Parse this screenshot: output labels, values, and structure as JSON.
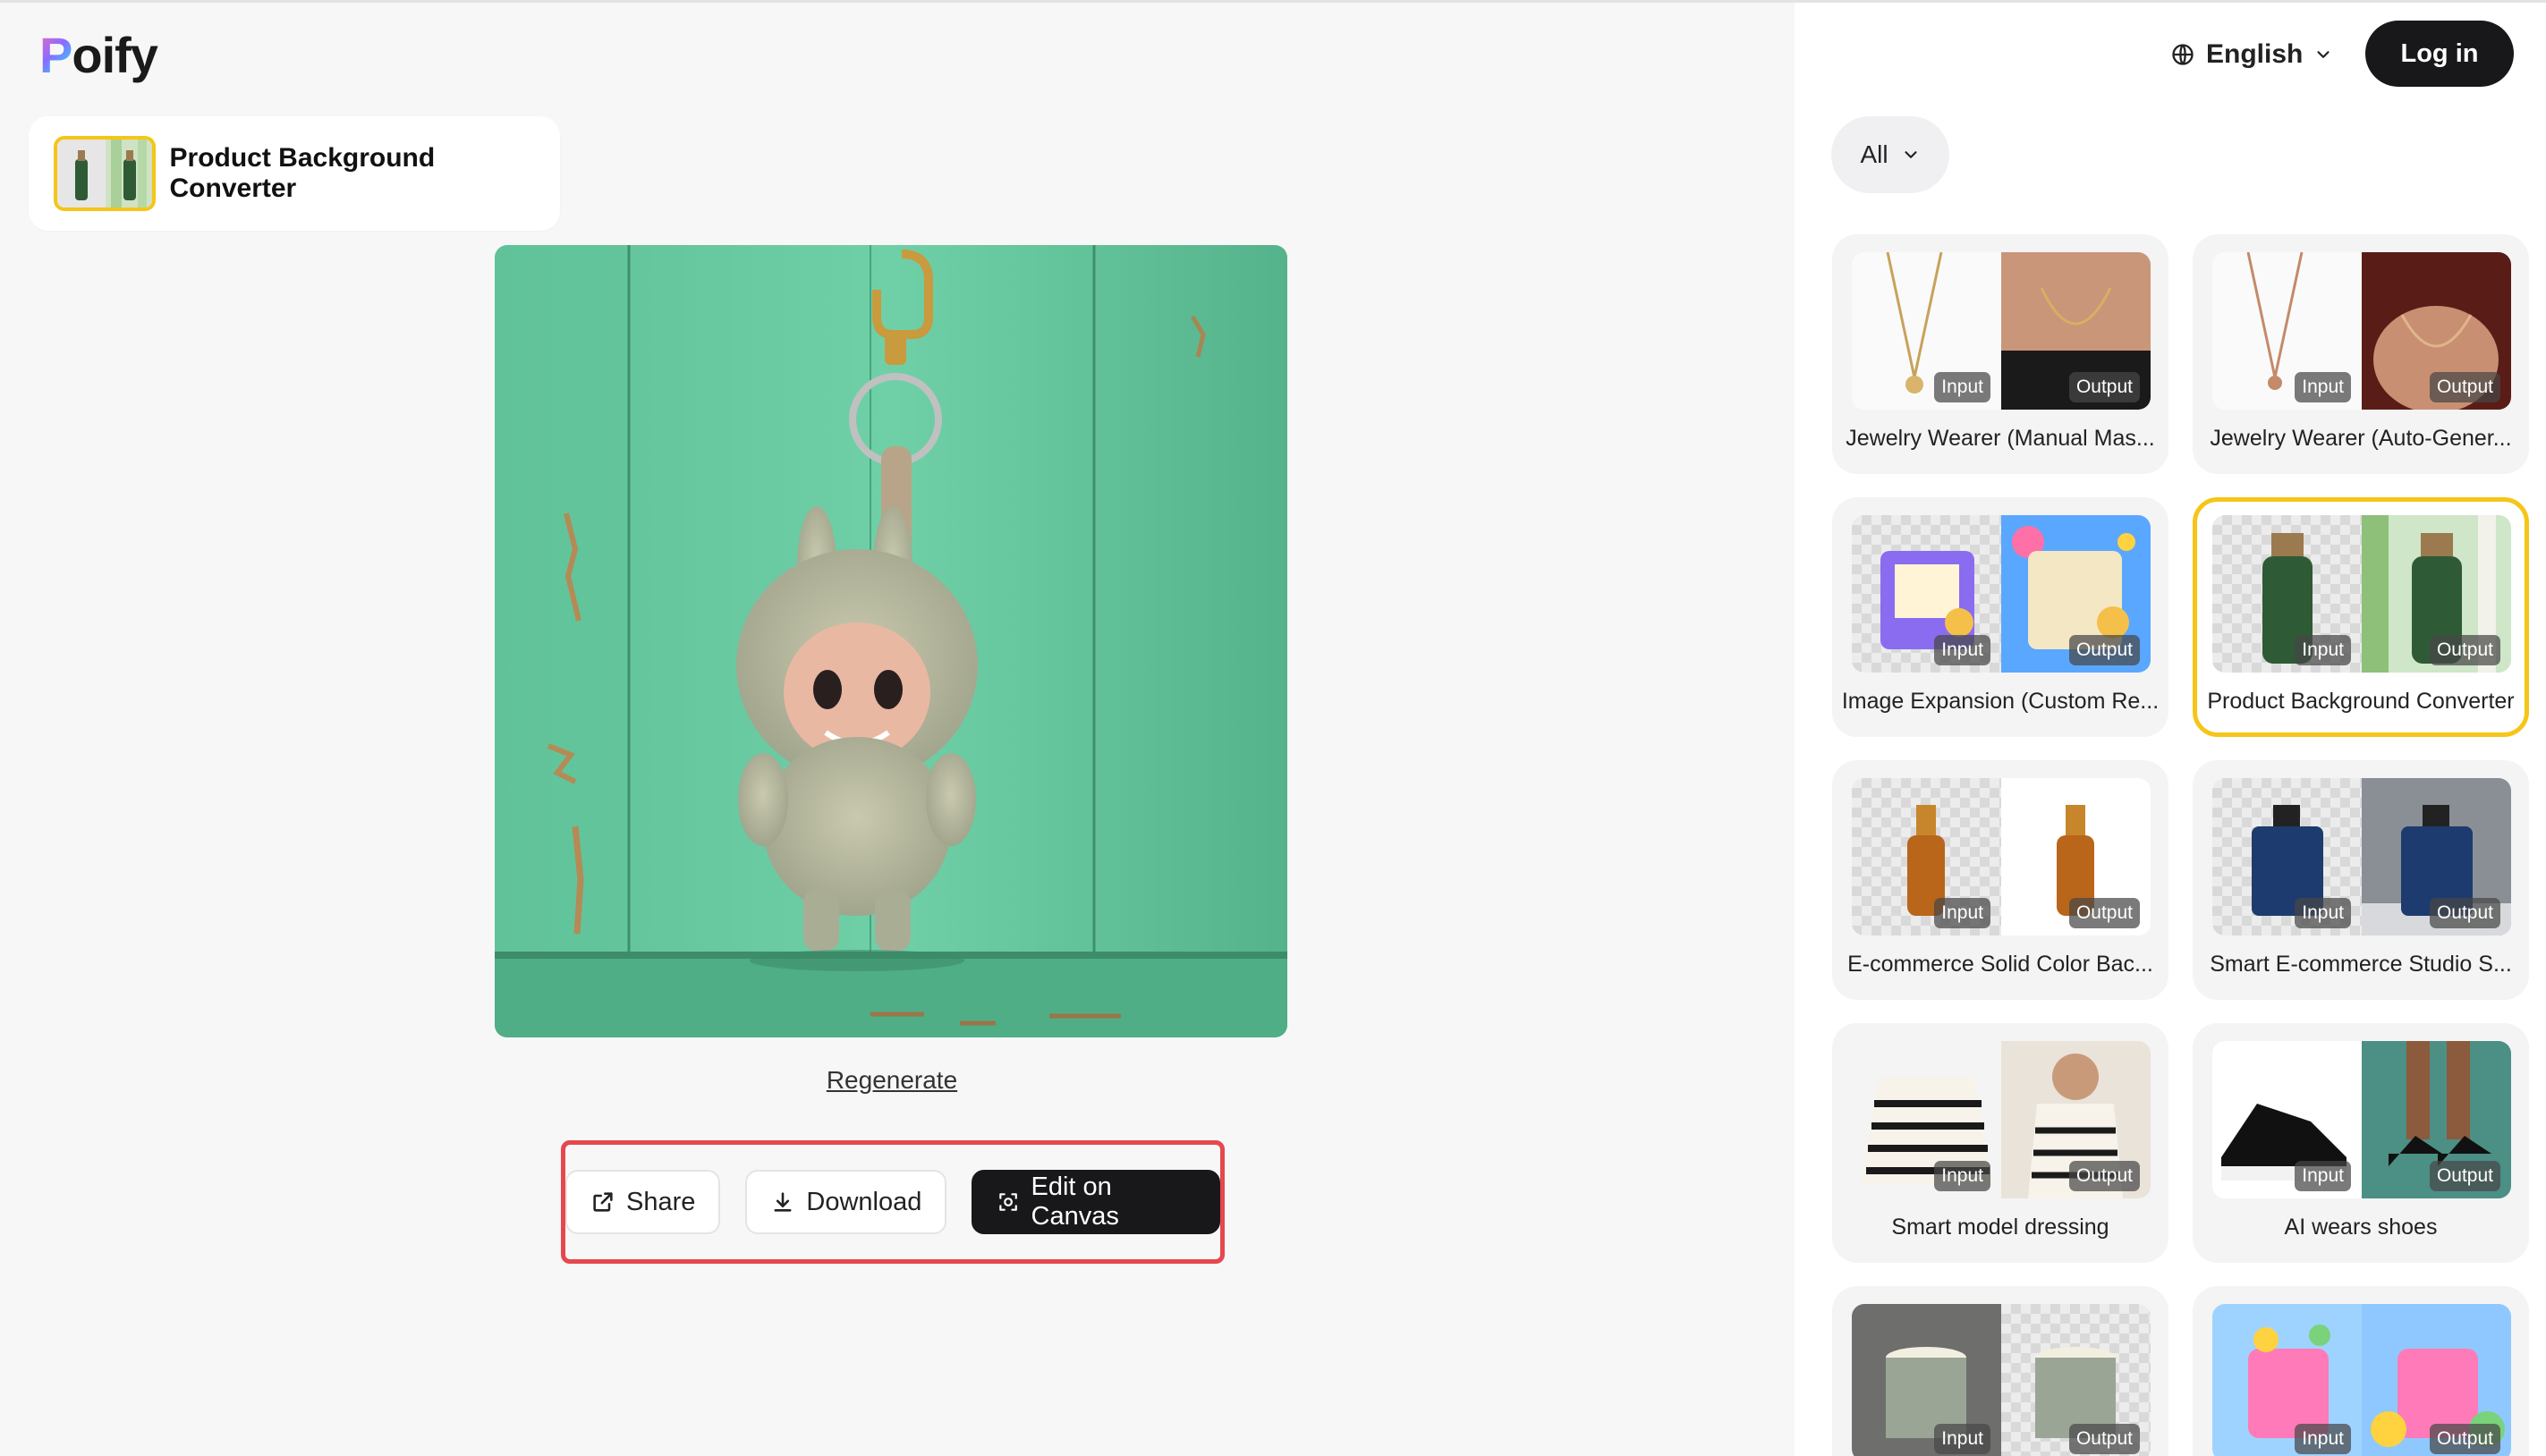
{
  "brand": {
    "name": "oify",
    "initial": "P"
  },
  "tool": {
    "name": "Product Background Converter"
  },
  "result": {
    "regenerate_label": "Regenerate"
  },
  "actions": {
    "share": "Share",
    "download": "Download",
    "edit": "Edit on Canvas"
  },
  "header": {
    "language": "English",
    "login": "Log in"
  },
  "filter": {
    "selected": "All"
  },
  "labels": {
    "input": "Input",
    "output": "Output"
  },
  "gallery": [
    {
      "title": "Jewelry Wearer (Manual Mas..."
    },
    {
      "title": "Jewelry Wearer (Auto-Gener..."
    },
    {
      "title": "Image Expansion (Custom Re..."
    },
    {
      "title": "Product Background Converter",
      "selected": true
    },
    {
      "title": "E-commerce Solid Color Bac..."
    },
    {
      "title": "Smart E-commerce Studio S..."
    },
    {
      "title": "Smart model dressing"
    },
    {
      "title": "AI wears shoes"
    },
    {
      "title": ""
    },
    {
      "title": ""
    }
  ],
  "colors": {
    "accent": "#f5c518",
    "highlight_box": "#e5484d",
    "dark": "#18181b"
  }
}
